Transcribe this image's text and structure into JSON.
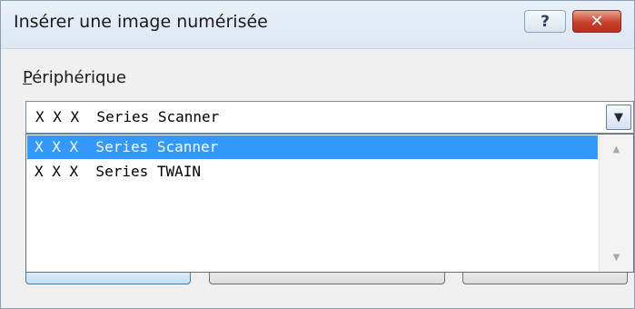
{
  "window": {
    "title": "Insérer une image numérisée",
    "help_label": "?",
    "close_label": "✕"
  },
  "device": {
    "label_first": "P",
    "label_rest": "ériphérique",
    "selected_value": "X X X  Series Scanner",
    "options": [
      {
        "label": "X X X  Series Scanner",
        "selected": true
      },
      {
        "label": "X X X  Series TWAIN",
        "selected": false
      }
    ]
  },
  "icons": {
    "dropdown": "chevron-down-icon",
    "scroll_up": "scroll-up-icon",
    "scroll_down": "scroll-down-icon"
  },
  "colors": {
    "selection": "#3399ff",
    "close_button": "#c7402a"
  }
}
